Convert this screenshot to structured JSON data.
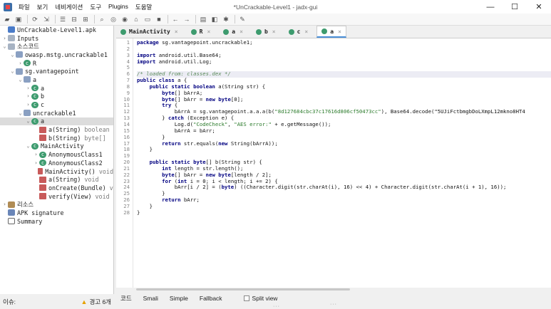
{
  "window": {
    "title": "*UnCrackable-Level1 - jadx-gui",
    "menu": [
      "파일",
      "보기",
      "네비게이션",
      "도구",
      "Plugins",
      "도움말"
    ],
    "controls": [
      "—",
      "☐",
      "✕"
    ]
  },
  "toolbar": {
    "icons": [
      "open-icon",
      "save-icon",
      "sep",
      "sync-icon",
      "export-icon",
      "sep",
      "flatten-icon",
      "collapse-icon",
      "expand-icon",
      "sep",
      "search-icon",
      "find-class-icon",
      "find-usage-icon",
      "home-icon",
      "list-icon",
      "stop-icon",
      "sep",
      "back-icon",
      "forward-icon",
      "sep",
      "log-icon",
      "quark-icon",
      "deobf-icon",
      "sep",
      "settings-icon"
    ]
  },
  "sidebar": {
    "items": [
      {
        "depth": 0,
        "arrow": "",
        "icon": "apk",
        "label": "UnCrackable-Level1.apk",
        "suffix": ""
      },
      {
        "depth": 0,
        "arrow": "›",
        "icon": "folder",
        "label": "Inputs",
        "suffix": ""
      },
      {
        "depth": 0,
        "arrow": "⌄",
        "icon": "folder",
        "label": "소스코드",
        "suffix": ""
      },
      {
        "depth": 1,
        "arrow": "⌄",
        "icon": "pkg",
        "label": "owasp.mstg.uncrackable1",
        "suffix": ""
      },
      {
        "depth": 2,
        "arrow": "›",
        "icon": "class",
        "label": "R",
        "suffix": ""
      },
      {
        "depth": 1,
        "arrow": "⌄",
        "icon": "pkg",
        "label": "sg.vantagepoint",
        "suffix": ""
      },
      {
        "depth": 2,
        "arrow": "⌄",
        "icon": "pkg",
        "label": "a",
        "suffix": ""
      },
      {
        "depth": 3,
        "arrow": "›",
        "icon": "class",
        "label": "a",
        "suffix": ""
      },
      {
        "depth": 3,
        "arrow": "›",
        "icon": "class",
        "label": "b",
        "suffix": ""
      },
      {
        "depth": 3,
        "arrow": "›",
        "icon": "class",
        "label": "c",
        "suffix": ""
      },
      {
        "depth": 2,
        "arrow": "⌄",
        "icon": "pkg",
        "label": "uncrackable1",
        "suffix": ""
      },
      {
        "depth": 3,
        "arrow": "⌄",
        "icon": "class",
        "label": "a",
        "suffix": "",
        "selected": true
      },
      {
        "depth": 4,
        "arrow": "",
        "icon": "method",
        "label": "a(String)",
        "suffix": "boolean"
      },
      {
        "depth": 4,
        "arrow": "",
        "icon": "method",
        "label": "b(String)",
        "suffix": "byte[]"
      },
      {
        "depth": 3,
        "arrow": "⌄",
        "icon": "class",
        "label": "MainActivity",
        "suffix": ""
      },
      {
        "depth": 4,
        "arrow": "›",
        "icon": "class",
        "label": "AnonymousClass1",
        "suffix": ""
      },
      {
        "depth": 4,
        "arrow": "›",
        "icon": "class",
        "label": "AnonymousClass2",
        "suffix": ""
      },
      {
        "depth": 4,
        "arrow": "",
        "icon": "method",
        "label": "MainActivity()",
        "suffix": "void"
      },
      {
        "depth": 4,
        "arrow": "",
        "icon": "method",
        "label": "a(String)",
        "suffix": "void"
      },
      {
        "depth": 4,
        "arrow": "",
        "icon": "method",
        "label": "onCreate(Bundle)",
        "suffix": "v"
      },
      {
        "depth": 4,
        "arrow": "",
        "icon": "method",
        "label": "verify(View)",
        "suffix": "void"
      },
      {
        "depth": 0,
        "arrow": "›",
        "icon": "res",
        "label": "리소스",
        "suffix": ""
      },
      {
        "depth": 0,
        "arrow": "",
        "icon": "cert",
        "label": "APK signature",
        "suffix": ""
      },
      {
        "depth": 0,
        "arrow": "",
        "icon": "summary",
        "label": "Summary",
        "suffix": ""
      }
    ]
  },
  "tabs": [
    {
      "label": "MainActivity",
      "active": false
    },
    {
      "label": "R",
      "active": false
    },
    {
      "label": "a",
      "active": false
    },
    {
      "label": "b",
      "active": false
    },
    {
      "label": "c",
      "active": false
    },
    {
      "label": "a",
      "active": true
    }
  ],
  "code": {
    "highlight_line": 6,
    "lines": [
      "package sg.vantagepoint.uncrackable1;",
      "",
      "import android.util.Base64;",
      "import android.util.Log;",
      "",
      "/* loaded from: classes.dex */",
      "public class a {",
      "    public static boolean a(String str) {",
      "        byte[] bArrA;",
      "        byte[] bArr = new byte[0];",
      "        try {",
      "            bArrA = sg.vantagepoint.a.a.a(b(\"8d127684cbc37c17616d806cf50473cc\"), Base64.decode(\"5UJiFctbmgbDoLXmpL12mkno8HT4",
      "        } catch (Exception e) {",
      "            Log.d(\"CodeCheck\", \"AES error:\" + e.getMessage());",
      "            bArrA = bArr;",
      "        }",
      "        return str.equals(new String(bArrA));",
      "    }",
      "",
      "    public static byte[] b(String str) {",
      "        int length = str.length();",
      "        byte[] bArr = new byte[length / 2];",
      "        for (int i = 0; i < length; i += 2) {",
      "            bArr[i / 2] = (byte) ((Character.digit(str.charAt(i), 16) << 4) + Character.digit(str.charAt(i + 1), 16));",
      "        }",
      "        return bArr;",
      "    }",
      "}"
    ]
  },
  "bottom_tabs": [
    "코드",
    "Smali",
    "Simple",
    "Fallback"
  ],
  "split_view_label": "Split view",
  "status": {
    "left": "이슈:",
    "warning": "경고 6개"
  }
}
